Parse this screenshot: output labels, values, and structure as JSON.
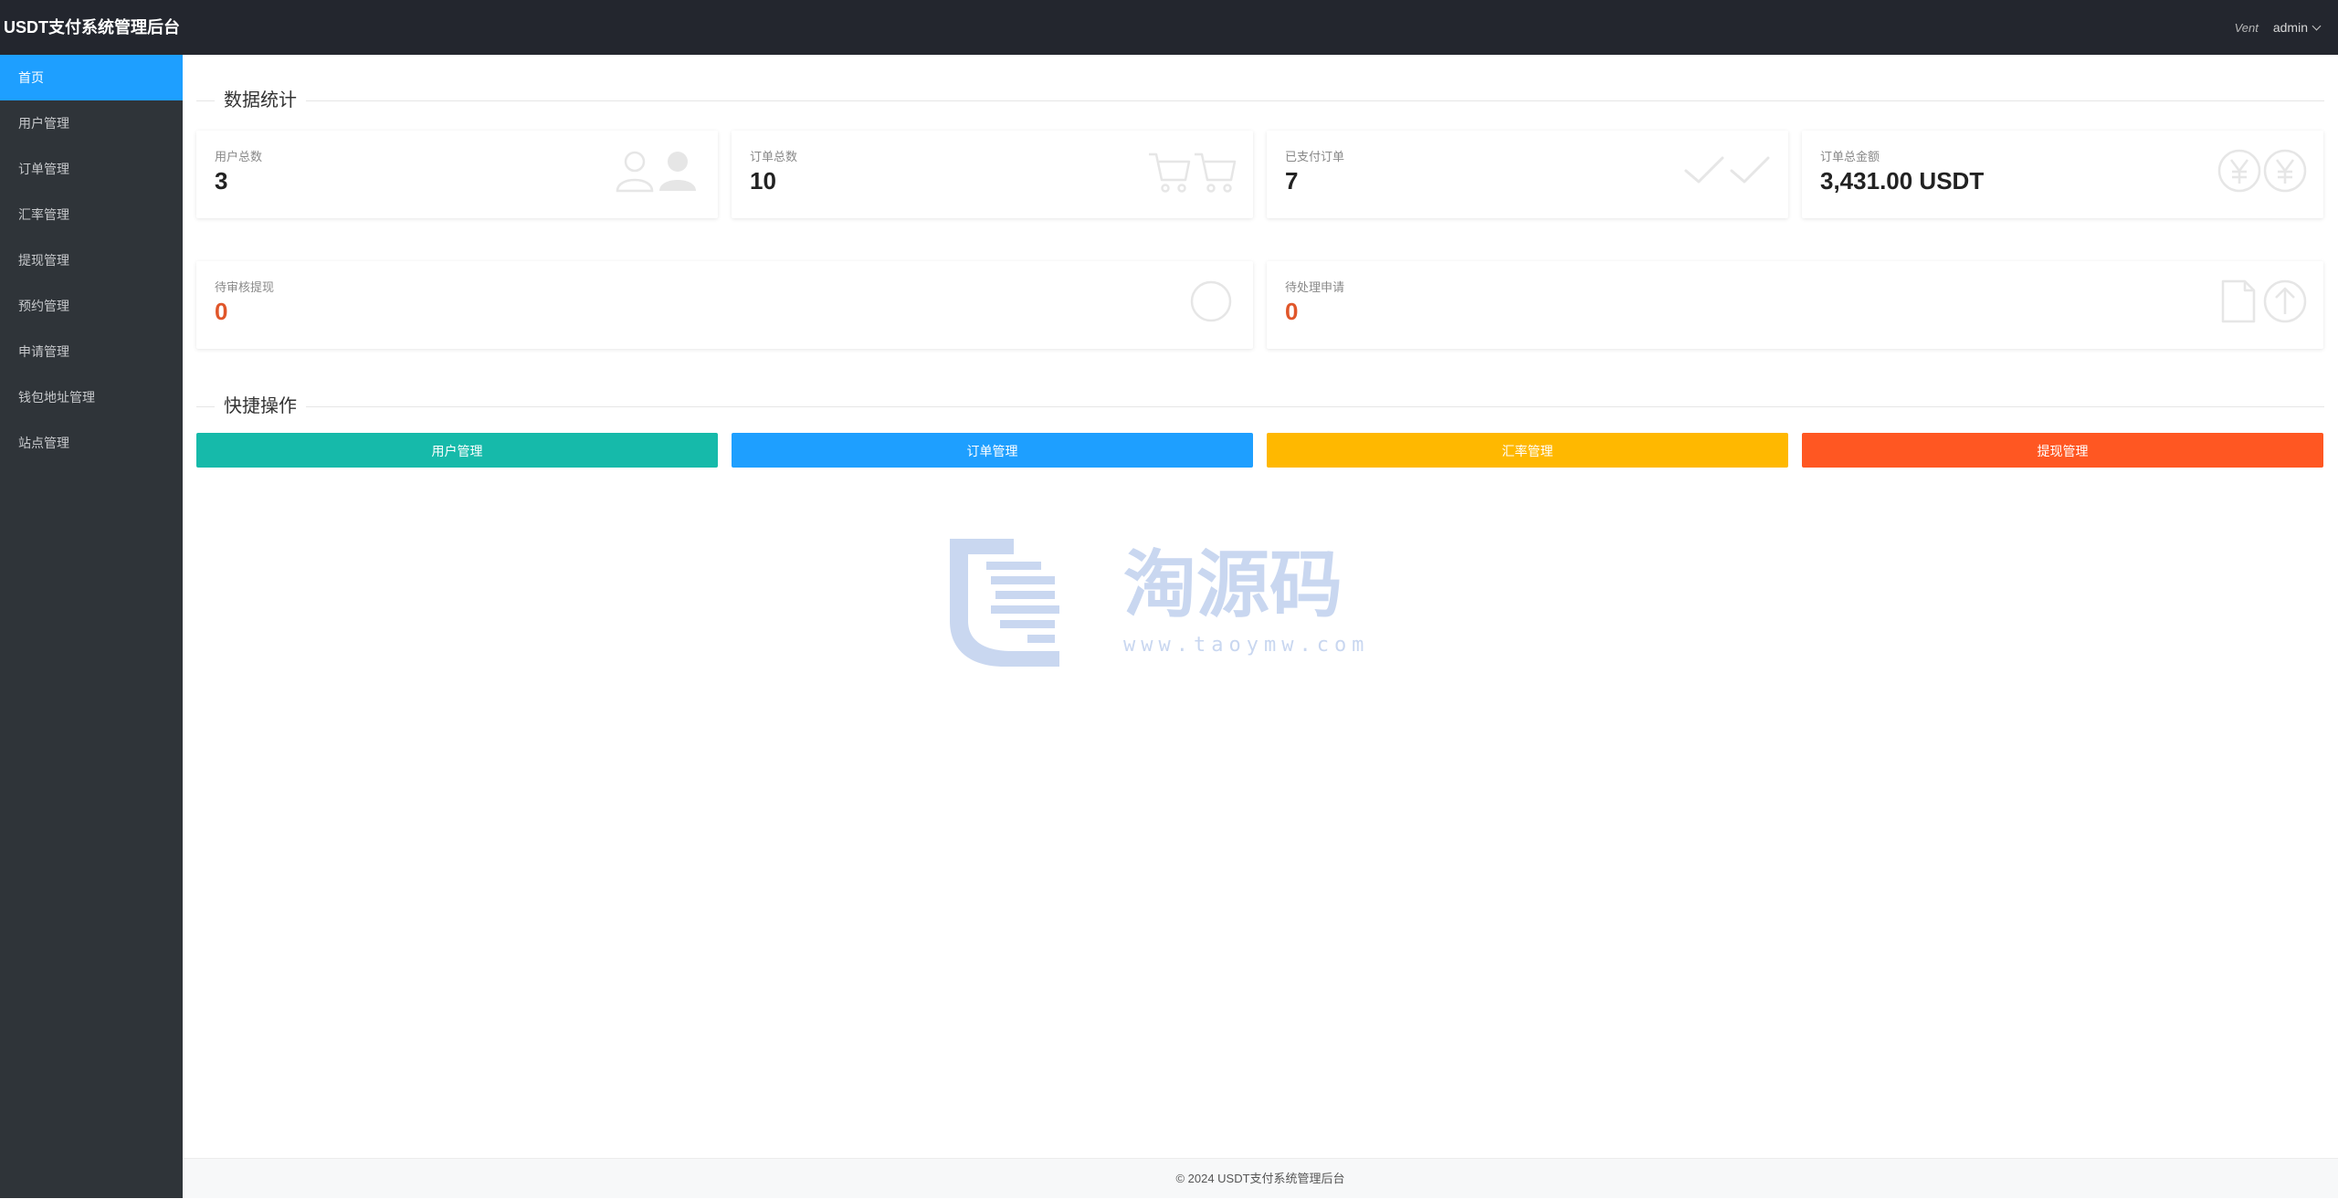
{
  "header": {
    "title": "USDT支付系统管理后台",
    "tool_label": "Vent",
    "user_name": "admin"
  },
  "sidebar": {
    "items": [
      {
        "label": "首页",
        "active": true
      },
      {
        "label": "用户管理"
      },
      {
        "label": "订单管理"
      },
      {
        "label": "汇率管理"
      },
      {
        "label": "提现管理"
      },
      {
        "label": "预约管理"
      },
      {
        "label": "申请管理"
      },
      {
        "label": "钱包地址管理"
      },
      {
        "label": "站点管理"
      }
    ]
  },
  "stats": {
    "section_title": "数据统计",
    "cards": [
      {
        "label": "用户总数",
        "value": "3",
        "icon": "users-icon"
      },
      {
        "label": "订单总数",
        "value": "10",
        "icon": "cart-icon"
      },
      {
        "label": "已支付订单",
        "value": "7",
        "icon": "check-icon"
      },
      {
        "label": "订单总金额",
        "value": "3,431.00 USDT",
        "icon": "yen-icon"
      },
      {
        "label": "待审核提现",
        "value": "0",
        "icon": "circle-icon"
      },
      {
        "label": "待处理申请",
        "value": "0",
        "icon": "file-upload-icon"
      }
    ]
  },
  "quick": {
    "section_title": "快捷操作",
    "buttons": [
      {
        "label": "用户管理",
        "color": "#16baaa"
      },
      {
        "label": "订单管理",
        "color": "#1e9fff"
      },
      {
        "label": "汇率管理",
        "color": "#ffb800"
      },
      {
        "label": "提现管理",
        "color": "#ff5722"
      }
    ]
  },
  "watermark": {
    "brand": "淘源码",
    "url": "www.taoymw.com"
  },
  "footer": {
    "text": "© 2024 USDT支付系统管理后台"
  },
  "colors": {
    "header_bg": "#23262e",
    "sidebar_bg": "#2f3439",
    "active_nav": "#1e9fff",
    "warn_value": "#e0562a"
  }
}
